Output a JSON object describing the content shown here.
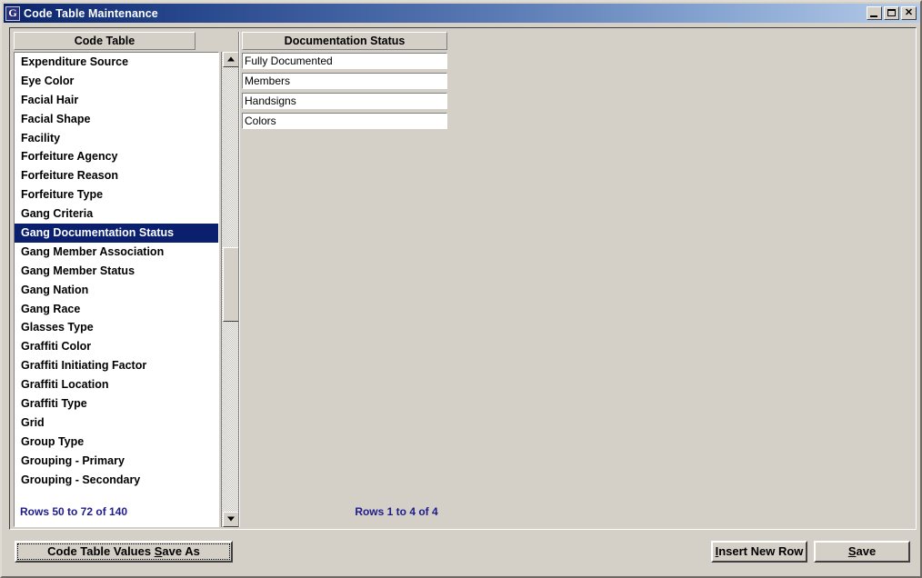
{
  "window": {
    "title": "Code Table Maintenance",
    "icon_name": "app-icon-g",
    "icon_glyph": "G",
    "caption_buttons": {
      "minimize": "minimize-icon",
      "maximize": "maximize-icon",
      "close": "✕"
    },
    "colors": {
      "titlebar_start": "#0a246a",
      "titlebar_end": "#b6cbe8",
      "face": "#d4d0c8",
      "selection": "#0a1f6e",
      "status_text": "#1c1c8c"
    }
  },
  "left_panel": {
    "header": "Code Table",
    "selected_index": 9,
    "items": [
      "Expenditure Source",
      "Eye Color",
      "Facial Hair",
      "Facial Shape",
      "Facility",
      "Forfeiture Agency",
      "Forfeiture Reason",
      "Forfeiture Type",
      "Gang Criteria",
      "Gang Documentation Status",
      "Gang Member Association",
      "Gang Member Status",
      "Gang Nation",
      "Gang Race",
      "Glasses Type",
      "Graffiti Color",
      "Graffiti Initiating Factor",
      "Graffiti Location",
      "Graffiti Type",
      "Grid",
      "Group Type",
      "Grouping - Primary",
      "Grouping - Secondary"
    ],
    "status": "Rows 50 to 72 of 140",
    "scrollbar": {
      "up_arrow": "scroll-up-icon",
      "down_arrow": "scroll-down-icon"
    }
  },
  "right_panel": {
    "header": "Documentation Status",
    "rows": [
      "Fully Documented",
      "Members",
      "Handsigns",
      "Colors"
    ],
    "status": "Rows 1 to 4 of 4"
  },
  "bottom_bar": {
    "save_as": {
      "before": "Code Table Values ",
      "accel": "S",
      "after": "ave As"
    },
    "insert_new_row": {
      "before": "",
      "accel": "I",
      "after": "nsert New Row"
    },
    "save": {
      "before": "",
      "accel": "S",
      "after": "ave"
    }
  }
}
